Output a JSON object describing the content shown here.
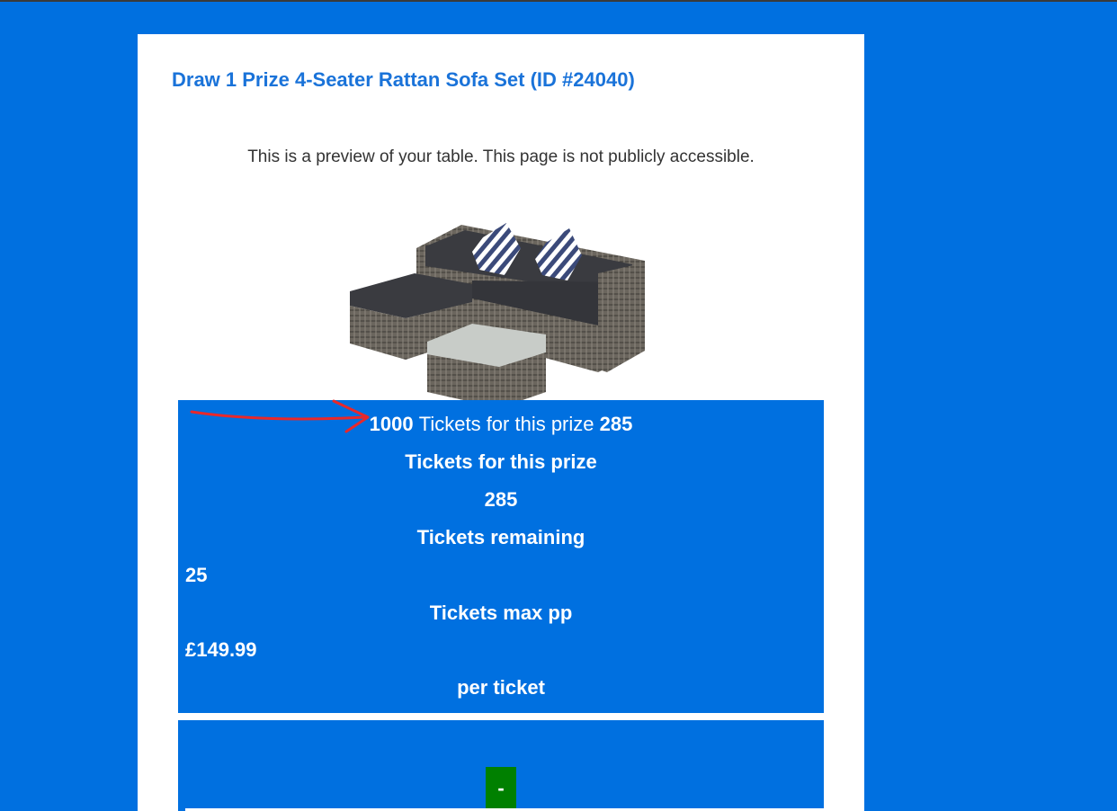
{
  "page": {
    "title": "Draw 1 Prize 4-Seater Rattan Sofa Set (ID #24040)",
    "preview_note": "This is a preview of your table. This page is not publicly accessible.",
    "product_image_icon": "rattan-sofa-set-image"
  },
  "info": {
    "summary_total": "1000",
    "summary_text": "Tickets for this prize",
    "summary_sold": "285",
    "tickets_for_prize_label": "Tickets for this prize",
    "tickets_sold_value": "285",
    "tickets_remaining_label": "Tickets remaining",
    "max_pp_value": "25",
    "max_pp_label": "Tickets max pp",
    "price_value": "£149.99",
    "price_label": "per ticket"
  },
  "actions": {
    "decrement_label": "-"
  },
  "colors": {
    "background": "#0070e0",
    "title": "#1a73d9",
    "button": "#008000",
    "annotation": "#e8282b"
  }
}
